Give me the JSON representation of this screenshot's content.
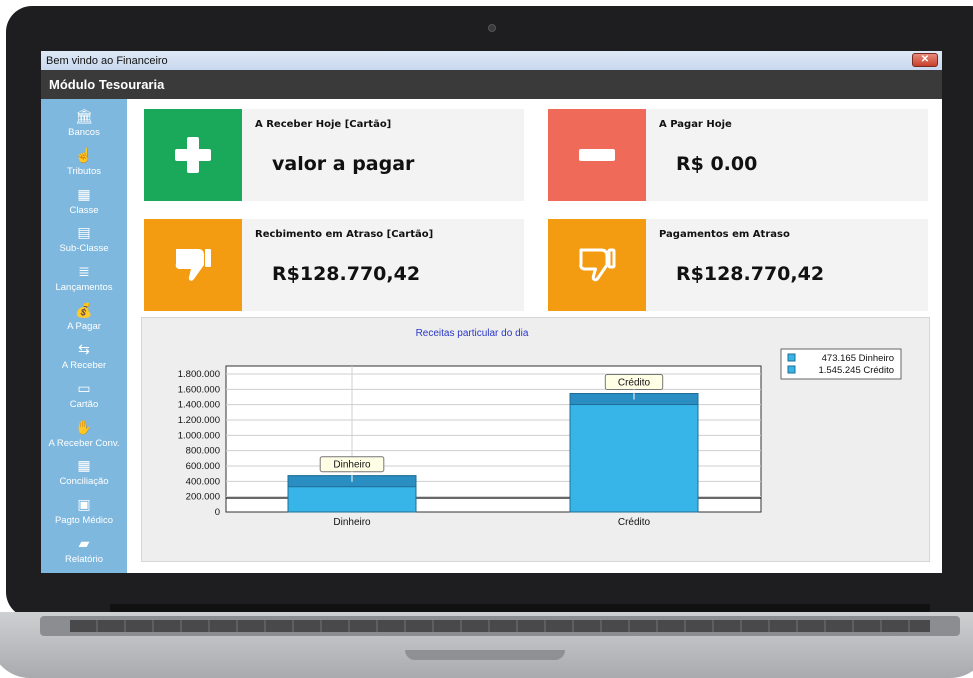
{
  "window": {
    "title": "Bem vindo ao Financeiro",
    "close_label": "✕"
  },
  "header": {
    "title": "Módulo Tesouraria"
  },
  "sidebar": {
    "items": [
      {
        "label": "Bancos",
        "icon": "bank-icon"
      },
      {
        "label": "Tributos",
        "icon": "hand-icon"
      },
      {
        "label": "Classe",
        "icon": "table-icon"
      },
      {
        "label": "Sub-Classe",
        "icon": "table-plus-icon"
      },
      {
        "label": "Lançamentos",
        "icon": "register-icon"
      },
      {
        "label": "A Pagar",
        "icon": "money-bag-icon"
      },
      {
        "label": "A Receber",
        "icon": "receive-money-icon"
      },
      {
        "label": "Cartão",
        "icon": "card-icon"
      },
      {
        "label": "A Receber Conv.",
        "icon": "hand-card-icon"
      },
      {
        "label": "Conciliação",
        "icon": "calculator-icon"
      },
      {
        "label": "Pagto Médico",
        "icon": "cash-icon"
      },
      {
        "label": "Relatório",
        "icon": "wallet-icon"
      }
    ]
  },
  "cards": {
    "receber_hoje": {
      "title": "A Receber Hoje [Cartão]",
      "value": "valor a pagar",
      "color": "#1aa85a",
      "icon": "plus-icon"
    },
    "pagar_hoje": {
      "title": "A Pagar Hoje",
      "value": "R$ 0.00",
      "color": "#f06a5a",
      "icon": "minus-icon"
    },
    "recebimento_atraso": {
      "title": "Recbimento em Atraso [Cartão]",
      "value": "R$128.770,42",
      "color": "#f39c12",
      "icon": "thumbs-down-filled-icon"
    },
    "pagamentos_atraso": {
      "title": "Pagamentos em Atraso",
      "value": "R$128.770,42",
      "color": "#f39c12",
      "icon": "thumbs-down-outline-icon"
    }
  },
  "chart_data": {
    "type": "bar",
    "title": "Receitas particular do dia",
    "categories": [
      "Dinheiro",
      "Crédito"
    ],
    "values": [
      473165,
      1545245
    ],
    "xlabel": "",
    "ylabel": "",
    "ylim": [
      0,
      1800000
    ],
    "yticks": [
      "0",
      "200.000",
      "400.000",
      "600.000",
      "800.000",
      "1.000.000",
      "1.200.000",
      "1.400.000",
      "1.600.000",
      "1.800.000"
    ],
    "bar_tooltips": [
      "Dinheiro",
      "Crédito"
    ],
    "legend": [
      "473.165 Dinheiro",
      "1.545.245 Crédito"
    ],
    "legend_position": "top-right",
    "grid": true,
    "bar_color": "#37b4e8"
  }
}
